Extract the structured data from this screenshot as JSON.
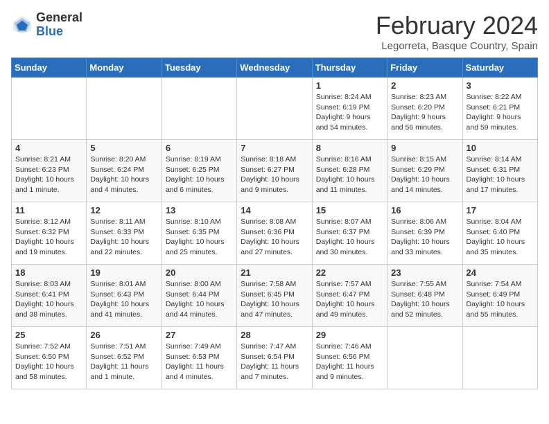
{
  "header": {
    "logo_general": "General",
    "logo_blue": "Blue",
    "month": "February 2024",
    "location": "Legorreta, Basque Country, Spain"
  },
  "days_of_week": [
    "Sunday",
    "Monday",
    "Tuesday",
    "Wednesday",
    "Thursday",
    "Friday",
    "Saturday"
  ],
  "weeks": [
    [
      {
        "day": "",
        "info": ""
      },
      {
        "day": "",
        "info": ""
      },
      {
        "day": "",
        "info": ""
      },
      {
        "day": "",
        "info": ""
      },
      {
        "day": "1",
        "info": "Sunrise: 8:24 AM\nSunset: 6:19 PM\nDaylight: 9 hours\nand 54 minutes."
      },
      {
        "day": "2",
        "info": "Sunrise: 8:23 AM\nSunset: 6:20 PM\nDaylight: 9 hours\nand 56 minutes."
      },
      {
        "day": "3",
        "info": "Sunrise: 8:22 AM\nSunset: 6:21 PM\nDaylight: 9 hours\nand 59 minutes."
      }
    ],
    [
      {
        "day": "4",
        "info": "Sunrise: 8:21 AM\nSunset: 6:23 PM\nDaylight: 10 hours\nand 1 minute."
      },
      {
        "day": "5",
        "info": "Sunrise: 8:20 AM\nSunset: 6:24 PM\nDaylight: 10 hours\nand 4 minutes."
      },
      {
        "day": "6",
        "info": "Sunrise: 8:19 AM\nSunset: 6:25 PM\nDaylight: 10 hours\nand 6 minutes."
      },
      {
        "day": "7",
        "info": "Sunrise: 8:18 AM\nSunset: 6:27 PM\nDaylight: 10 hours\nand 9 minutes."
      },
      {
        "day": "8",
        "info": "Sunrise: 8:16 AM\nSunset: 6:28 PM\nDaylight: 10 hours\nand 11 minutes."
      },
      {
        "day": "9",
        "info": "Sunrise: 8:15 AM\nSunset: 6:29 PM\nDaylight: 10 hours\nand 14 minutes."
      },
      {
        "day": "10",
        "info": "Sunrise: 8:14 AM\nSunset: 6:31 PM\nDaylight: 10 hours\nand 17 minutes."
      }
    ],
    [
      {
        "day": "11",
        "info": "Sunrise: 8:12 AM\nSunset: 6:32 PM\nDaylight: 10 hours\nand 19 minutes."
      },
      {
        "day": "12",
        "info": "Sunrise: 8:11 AM\nSunset: 6:33 PM\nDaylight: 10 hours\nand 22 minutes."
      },
      {
        "day": "13",
        "info": "Sunrise: 8:10 AM\nSunset: 6:35 PM\nDaylight: 10 hours\nand 25 minutes."
      },
      {
        "day": "14",
        "info": "Sunrise: 8:08 AM\nSunset: 6:36 PM\nDaylight: 10 hours\nand 27 minutes."
      },
      {
        "day": "15",
        "info": "Sunrise: 8:07 AM\nSunset: 6:37 PM\nDaylight: 10 hours\nand 30 minutes."
      },
      {
        "day": "16",
        "info": "Sunrise: 8:06 AM\nSunset: 6:39 PM\nDaylight: 10 hours\nand 33 minutes."
      },
      {
        "day": "17",
        "info": "Sunrise: 8:04 AM\nSunset: 6:40 PM\nDaylight: 10 hours\nand 35 minutes."
      }
    ],
    [
      {
        "day": "18",
        "info": "Sunrise: 8:03 AM\nSunset: 6:41 PM\nDaylight: 10 hours\nand 38 minutes."
      },
      {
        "day": "19",
        "info": "Sunrise: 8:01 AM\nSunset: 6:43 PM\nDaylight: 10 hours\nand 41 minutes."
      },
      {
        "day": "20",
        "info": "Sunrise: 8:00 AM\nSunset: 6:44 PM\nDaylight: 10 hours\nand 44 minutes."
      },
      {
        "day": "21",
        "info": "Sunrise: 7:58 AM\nSunset: 6:45 PM\nDaylight: 10 hours\nand 47 minutes."
      },
      {
        "day": "22",
        "info": "Sunrise: 7:57 AM\nSunset: 6:47 PM\nDaylight: 10 hours\nand 49 minutes."
      },
      {
        "day": "23",
        "info": "Sunrise: 7:55 AM\nSunset: 6:48 PM\nDaylight: 10 hours\nand 52 minutes."
      },
      {
        "day": "24",
        "info": "Sunrise: 7:54 AM\nSunset: 6:49 PM\nDaylight: 10 hours\nand 55 minutes."
      }
    ],
    [
      {
        "day": "25",
        "info": "Sunrise: 7:52 AM\nSunset: 6:50 PM\nDaylight: 10 hours\nand 58 minutes."
      },
      {
        "day": "26",
        "info": "Sunrise: 7:51 AM\nSunset: 6:52 PM\nDaylight: 11 hours\nand 1 minute."
      },
      {
        "day": "27",
        "info": "Sunrise: 7:49 AM\nSunset: 6:53 PM\nDaylight: 11 hours\nand 4 minutes."
      },
      {
        "day": "28",
        "info": "Sunrise: 7:47 AM\nSunset: 6:54 PM\nDaylight: 11 hours\nand 7 minutes."
      },
      {
        "day": "29",
        "info": "Sunrise: 7:46 AM\nSunset: 6:56 PM\nDaylight: 11 hours\nand 9 minutes."
      },
      {
        "day": "",
        "info": ""
      },
      {
        "day": "",
        "info": ""
      }
    ]
  ]
}
